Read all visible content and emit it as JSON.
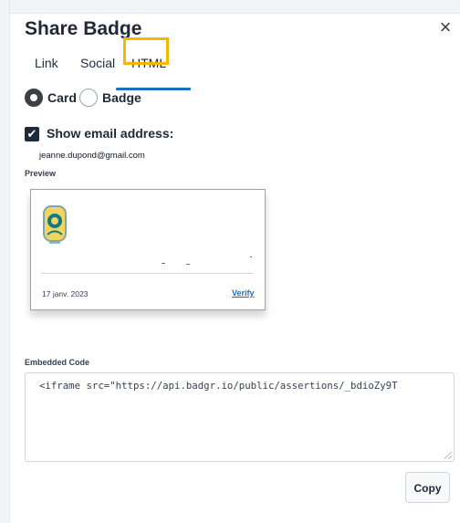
{
  "dialog": {
    "title": "Share Badge",
    "close_icon": "×"
  },
  "tabs": [
    {
      "label": "Link",
      "active": false
    },
    {
      "label": "Social",
      "active": false
    },
    {
      "label": "HTML",
      "active": true
    }
  ],
  "format": {
    "options": [
      {
        "label": "Card",
        "selected": true
      },
      {
        "label": "Badge",
        "selected": false
      }
    ]
  },
  "email": {
    "show_label": "Show email address:",
    "checked": true,
    "value": "jeanne.dupond@gmail.com"
  },
  "preview": {
    "label": "Preview",
    "date": "17 janv. 2023",
    "verify_label": "Verify"
  },
  "embed": {
    "label": "Embedded Code",
    "code": "<iframe src=\"https://api.badgr.io/public/assertions/_bdioZy9T"
  },
  "copy_label": "Copy",
  "colors": {
    "accent": "#1d6fc1",
    "highlight": "#f5b800",
    "checkbox_bg": "#1f2b3a"
  }
}
